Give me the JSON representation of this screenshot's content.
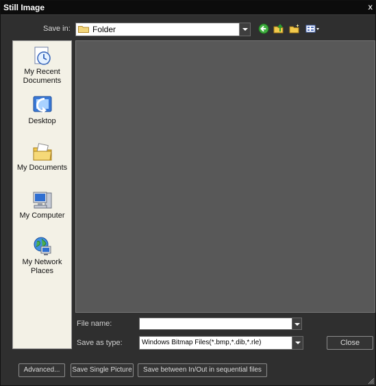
{
  "window": {
    "title": "Still Image",
    "close_glyph": "x"
  },
  "save_in": {
    "label": "Save in:",
    "value": "Folder",
    "icon": "folder-icon"
  },
  "toolbar": {
    "icons": [
      "back-icon",
      "up-folder-icon",
      "new-folder-icon",
      "view-menu-icon"
    ]
  },
  "places": [
    {
      "label": "My Recent Documents",
      "icon": "recent-documents-icon"
    },
    {
      "label": "Desktop",
      "icon": "desktop-icon"
    },
    {
      "label": "My Documents",
      "icon": "my-documents-icon"
    },
    {
      "label": "My Computer",
      "icon": "my-computer-icon"
    },
    {
      "label": "My Network Places",
      "icon": "network-places-icon"
    }
  ],
  "file_name": {
    "label": "File name:",
    "value": ""
  },
  "save_as_type": {
    "label": "Save as type:",
    "value": "Windows Bitmap Files(*.bmp,*.dib,*.rle)"
  },
  "buttons": {
    "close": "Close",
    "advanced": "Advanced...",
    "save_single": "Save Single Picture",
    "save_sequential": "Save between In/Out in sequential files"
  },
  "colors": {
    "dialog_bg": "#2f2f2f",
    "file_list_bg": "#585858",
    "places_bg": "#f3f1e6",
    "title_bar": "#0c0c0c"
  }
}
